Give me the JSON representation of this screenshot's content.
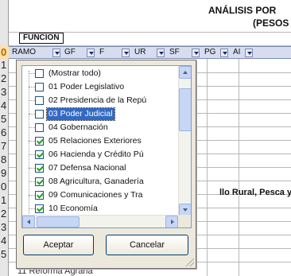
{
  "sheet": {
    "title": "ANÁLISIS POR",
    "subtitle": "(PESOS",
    "funcion_label": "FUNCION",
    "visible_cell_text": "llo Rural, Pesca y",
    "bottom_partial_text": "11 Reforma Agraria",
    "row_numbers": [
      "0",
      "1",
      "2",
      "3",
      "4",
      "5",
      "6",
      "7",
      "8",
      "9",
      "0",
      "1",
      "2",
      "3",
      "4",
      "5"
    ],
    "selected_row_index": 0
  },
  "filter_headers": [
    {
      "label": "RAMO"
    },
    {
      "label": "GF"
    },
    {
      "label": "F"
    },
    {
      "label": "UR"
    },
    {
      "label": "SF"
    },
    {
      "label": "PG"
    },
    {
      "label": "AI"
    }
  ],
  "filter_popup": {
    "items": [
      {
        "label": "(Mostrar todo)",
        "checked": false
      },
      {
        "label": "01 Poder Legislativo",
        "checked": false
      },
      {
        "label": "02 Presidencia de la Repú",
        "checked": false
      },
      {
        "label": "03 Poder Judicial",
        "checked": false,
        "selected": true
      },
      {
        "label": "04 Gobernación",
        "checked": false
      },
      {
        "label": "05 Relaciones Exteriores",
        "checked": true
      },
      {
        "label": "06 Hacienda y Crédito Pú",
        "checked": true
      },
      {
        "label": "07 Defensa Nacional",
        "checked": true
      },
      {
        "label": "08 Agricultura, Ganadería",
        "checked": true
      },
      {
        "label": "09 Comunicaciones y Tra",
        "checked": true
      },
      {
        "label": "10 Economía",
        "checked": true
      }
    ],
    "ok_button": "Aceptar",
    "cancel_button": "Cancelar"
  },
  "colors": {
    "selection": "#316ac5",
    "checkmark": "#21a121",
    "dialog_bg": "#ece9dc"
  }
}
